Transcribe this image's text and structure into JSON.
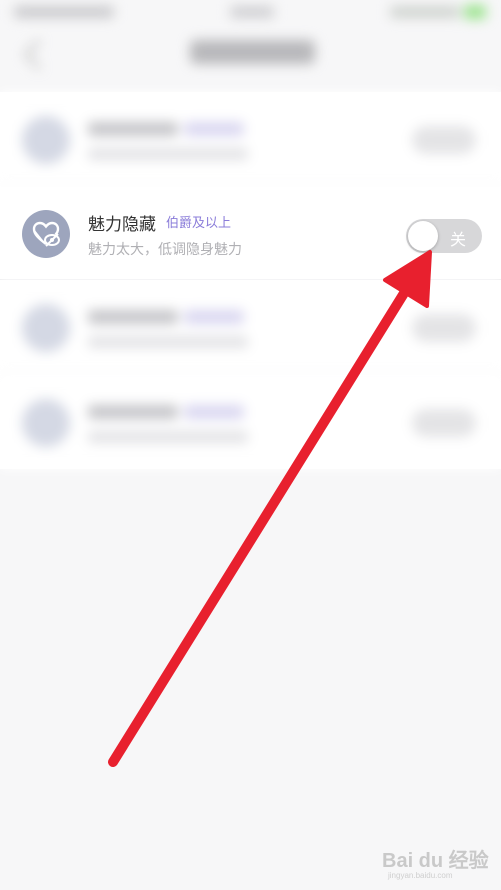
{
  "setting": {
    "title": "魅力隐藏",
    "badge": "伯爵及以上",
    "description": "魅力太大，低调隐身魅力",
    "icon": "heart-hidden-icon",
    "toggle_label": "关",
    "toggle_on": false
  },
  "colors": {
    "icon_bg": "#9da5bd",
    "badge": "#8a7cd9",
    "toggle_off": "#d7d7d9",
    "arrow": "#e8202e"
  },
  "watermark": {
    "text": "Bai du 经验",
    "sub": "jingyan.baidu.com"
  }
}
